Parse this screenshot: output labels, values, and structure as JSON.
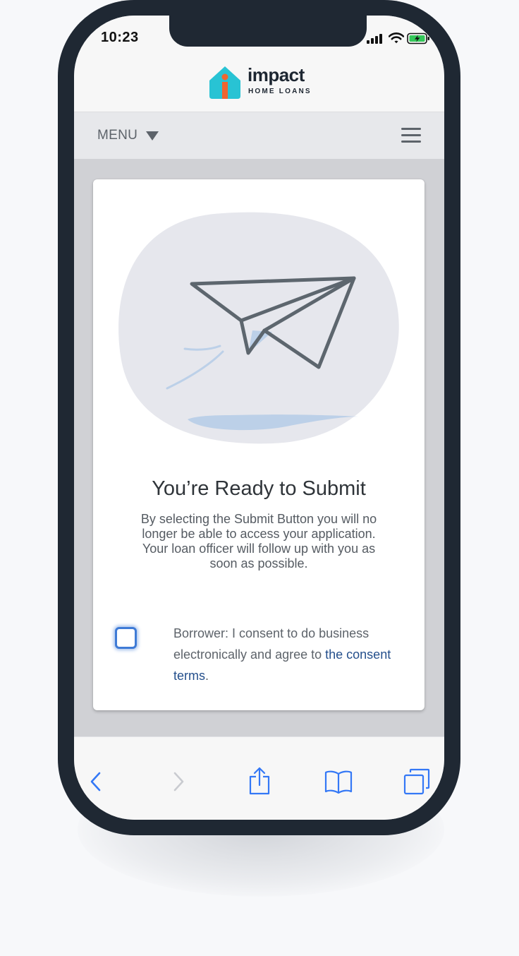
{
  "status_bar": {
    "time": "10:23",
    "icons": [
      "cellular-signal-icon",
      "wifi-icon",
      "battery-charging-icon"
    ]
  },
  "header": {
    "logo_word": "impact",
    "logo_subtitle": "HOME LOANS",
    "logo_icon": "house-logo-icon",
    "brand_colors": {
      "teal": "#28c3d4",
      "orange": "#f0652f",
      "navy": "#1d2631"
    }
  },
  "nav": {
    "menu_label": "MENU",
    "menu_icon": "caret-down-icon",
    "hamburger_icon": "hamburger-menu-icon"
  },
  "card": {
    "illustration_icon": "paper-airplane-illustration",
    "title": "You’re Ready to Submit",
    "body": "By selecting the Submit Button you will no longer be able to access your application. Your loan officer will follow up with you as soon as possible.",
    "consent": {
      "checked": false,
      "text_before": "Borrower: I consent to do business electronically and agree to ",
      "link": "the consent terms",
      "text_after": "."
    }
  },
  "browser_toolbar": {
    "items": [
      "back-icon",
      "forward-icon",
      "share-icon",
      "bookmarks-icon",
      "tabs-icon"
    ],
    "accent": "#3478f6"
  }
}
